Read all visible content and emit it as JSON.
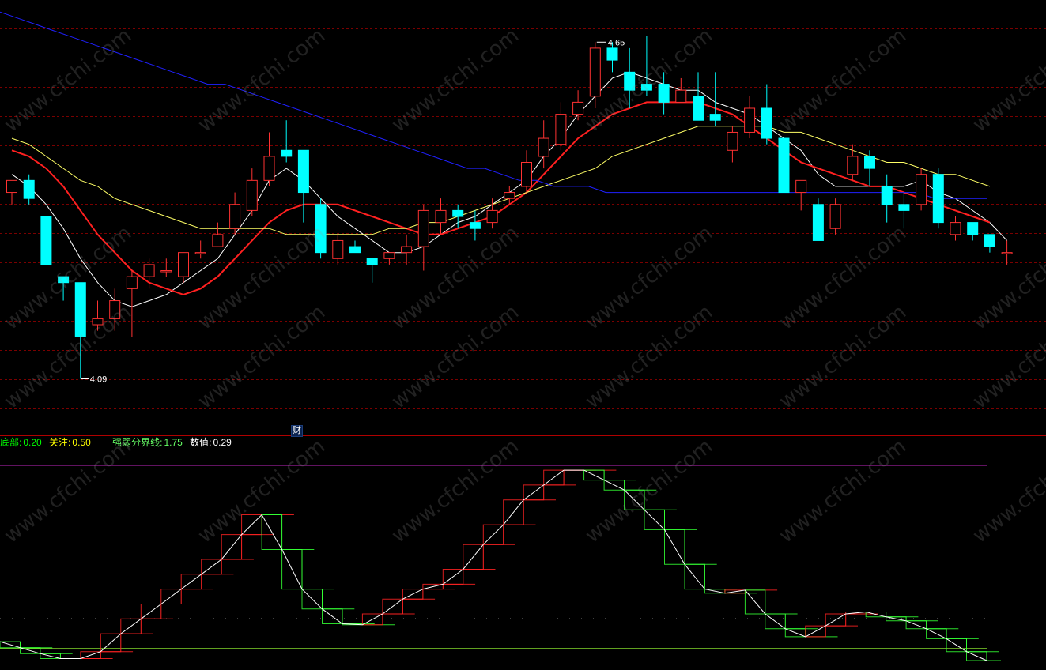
{
  "chart_data": [
    {
      "type": "candlestick",
      "title": "",
      "ylim": [
        4.0,
        4.72
      ],
      "max_label": "4.65",
      "min_label": "4.09",
      "badge": "财",
      "colors": {
        "up": "#ff3232",
        "down": "#00ffff",
        "ma_short": "#ffffff",
        "ma_mid": "#ff2020",
        "ma_long": "#ffff66",
        "ma_longest": "#2020ff",
        "grid": "#7a0000"
      },
      "candles": [
        {
          "o": 4.4,
          "c": 4.42,
          "h": 4.42,
          "l": 4.38
        },
        {
          "o": 4.42,
          "c": 4.39,
          "h": 4.43,
          "l": 4.38
        },
        {
          "o": 4.36,
          "c": 4.28,
          "h": 4.36,
          "l": 4.28
        },
        {
          "o": 4.26,
          "c": 4.25,
          "h": 4.26,
          "l": 4.22
        },
        {
          "o": 4.25,
          "c": 4.16,
          "h": 4.25,
          "l": 4.09
        },
        {
          "o": 4.18,
          "c": 4.19,
          "h": 4.22,
          "l": 4.17
        },
        {
          "o": 4.19,
          "c": 4.22,
          "h": 4.24,
          "l": 4.17
        },
        {
          "o": 4.24,
          "c": 4.26,
          "h": 4.27,
          "l": 4.16
        },
        {
          "o": 4.26,
          "c": 4.28,
          "h": 4.29,
          "l": 4.24
        },
        {
          "o": 4.27,
          "c": 4.27,
          "h": 4.29,
          "l": 4.26
        },
        {
          "o": 4.26,
          "c": 4.3,
          "h": 4.3,
          "l": 4.25
        },
        {
          "o": 4.3,
          "c": 4.3,
          "h": 4.32,
          "l": 4.29
        },
        {
          "o": 4.31,
          "c": 4.33,
          "h": 4.35,
          "l": 4.31
        },
        {
          "o": 4.34,
          "c": 4.38,
          "h": 4.4,
          "l": 4.33
        },
        {
          "o": 4.37,
          "c": 4.42,
          "h": 4.44,
          "l": 4.36
        },
        {
          "o": 4.42,
          "c": 4.46,
          "h": 4.5,
          "l": 4.41
        },
        {
          "o": 4.47,
          "c": 4.46,
          "h": 4.52,
          "l": 4.45
        },
        {
          "o": 4.47,
          "c": 4.4,
          "h": 4.47,
          "l": 4.35
        },
        {
          "o": 4.38,
          "c": 4.3,
          "h": 4.39,
          "l": 4.29
        },
        {
          "o": 4.29,
          "c": 4.32,
          "h": 4.33,
          "l": 4.28
        },
        {
          "o": 4.31,
          "c": 4.3,
          "h": 4.32,
          "l": 4.3
        },
        {
          "o": 4.29,
          "c": 4.28,
          "h": 4.29,
          "l": 4.25
        },
        {
          "o": 4.29,
          "c": 4.3,
          "h": 4.3,
          "l": 4.28
        },
        {
          "o": 4.3,
          "c": 4.31,
          "h": 4.33,
          "l": 4.28
        },
        {
          "o": 4.31,
          "c": 4.37,
          "h": 4.38,
          "l": 4.27
        },
        {
          "o": 4.35,
          "c": 4.37,
          "h": 4.39,
          "l": 4.33
        },
        {
          "o": 4.37,
          "c": 4.36,
          "h": 4.38,
          "l": 4.34
        },
        {
          "o": 4.35,
          "c": 4.34,
          "h": 4.37,
          "l": 4.32
        },
        {
          "o": 4.35,
          "c": 4.37,
          "h": 4.39,
          "l": 4.34
        },
        {
          "o": 4.39,
          "c": 4.4,
          "h": 4.41,
          "l": 4.38
        },
        {
          "o": 4.41,
          "c": 4.45,
          "h": 4.47,
          "l": 4.4
        },
        {
          "o": 4.46,
          "c": 4.49,
          "h": 4.52,
          "l": 4.44
        },
        {
          "o": 4.48,
          "c": 4.53,
          "h": 4.55,
          "l": 4.47
        },
        {
          "o": 4.53,
          "c": 4.55,
          "h": 4.57,
          "l": 4.52
        },
        {
          "o": 4.56,
          "c": 4.64,
          "h": 4.65,
          "l": 4.54
        },
        {
          "o": 4.64,
          "c": 4.62,
          "h": 4.65,
          "l": 4.6
        },
        {
          "o": 4.6,
          "c": 4.57,
          "h": 4.64,
          "l": 4.54
        },
        {
          "o": 4.58,
          "c": 4.57,
          "h": 4.66,
          "l": 4.56
        },
        {
          "o": 4.58,
          "c": 4.55,
          "h": 4.6,
          "l": 4.53
        },
        {
          "o": 4.55,
          "c": 4.57,
          "h": 4.59,
          "l": 4.55
        },
        {
          "o": 4.56,
          "c": 4.52,
          "h": 4.6,
          "l": 4.52
        },
        {
          "o": 4.53,
          "c": 4.52,
          "h": 4.6,
          "l": 4.51
        },
        {
          "o": 4.47,
          "c": 4.5,
          "h": 4.51,
          "l": 4.45
        },
        {
          "o": 4.5,
          "c": 4.54,
          "h": 4.56,
          "l": 4.49
        },
        {
          "o": 4.54,
          "c": 4.49,
          "h": 4.58,
          "l": 4.48
        },
        {
          "o": 4.49,
          "c": 4.4,
          "h": 4.49,
          "l": 4.37
        },
        {
          "o": 4.4,
          "c": 4.42,
          "h": 4.42,
          "l": 4.37
        },
        {
          "o": 4.38,
          "c": 4.32,
          "h": 4.39,
          "l": 4.32
        },
        {
          "o": 4.34,
          "c": 4.38,
          "h": 4.39,
          "l": 4.33
        },
        {
          "o": 4.43,
          "c": 4.46,
          "h": 4.48,
          "l": 4.42
        },
        {
          "o": 4.46,
          "c": 4.44,
          "h": 4.47,
          "l": 4.41
        },
        {
          "o": 4.41,
          "c": 4.38,
          "h": 4.43,
          "l": 4.35
        },
        {
          "o": 4.38,
          "c": 4.37,
          "h": 4.4,
          "l": 4.34
        },
        {
          "o": 4.38,
          "c": 4.43,
          "h": 4.44,
          "l": 4.37
        },
        {
          "o": 4.43,
          "c": 4.35,
          "h": 4.44,
          "l": 4.34
        },
        {
          "o": 4.33,
          "c": 4.35,
          "h": 4.36,
          "l": 4.32
        },
        {
          "o": 4.35,
          "c": 4.33,
          "h": 4.35,
          "l": 4.32
        },
        {
          "o": 4.33,
          "c": 4.31,
          "h": 4.33,
          "l": 4.3
        },
        {
          "o": 4.3,
          "c": 4.3,
          "h": 4.32,
          "l": 4.28
        }
      ],
      "ma": [
        {
          "name": "short",
          "color": "#ffffff",
          "width": 1,
          "values": [
            4.43,
            4.41,
            4.38,
            4.34,
            4.29,
            4.25,
            4.22,
            4.21,
            4.22,
            4.23,
            4.25,
            4.27,
            4.29,
            4.33,
            4.37,
            4.42,
            4.44,
            4.42,
            4.39,
            4.36,
            4.34,
            4.32,
            4.3,
            4.3,
            4.31,
            4.33,
            4.35,
            4.36,
            4.38,
            4.4,
            4.42,
            4.46,
            4.49,
            4.53,
            4.56,
            4.59,
            4.6,
            4.59,
            4.58,
            4.57,
            4.57,
            4.55,
            4.54,
            4.53,
            4.51,
            4.49,
            4.47,
            4.43,
            4.41,
            4.41,
            4.41,
            4.41,
            4.41,
            4.42,
            4.4,
            4.39,
            4.37,
            4.35,
            4.32
          ]
        },
        {
          "name": "mid",
          "color": "#ff2020",
          "width": 2,
          "values": [
            4.47,
            4.46,
            4.44,
            4.41,
            4.37,
            4.33,
            4.3,
            4.27,
            4.25,
            4.24,
            4.23,
            4.24,
            4.26,
            4.29,
            4.32,
            4.35,
            4.37,
            4.38,
            4.38,
            4.38,
            4.37,
            4.36,
            4.35,
            4.34,
            4.33,
            4.33,
            4.34,
            4.35,
            4.36,
            4.38,
            4.4,
            4.43,
            4.46,
            4.49,
            4.51,
            4.53,
            4.54,
            4.55,
            4.55,
            4.55,
            4.55,
            4.54,
            4.53,
            4.51,
            4.49,
            4.47,
            4.45,
            4.44,
            4.43,
            4.42,
            4.41,
            4.41,
            4.4,
            4.39,
            4.38,
            4.37,
            4.36,
            4.35
          ]
        },
        {
          "name": "long",
          "color": "#ffff66",
          "width": 1,
          "values": [
            4.49,
            4.48,
            4.46,
            4.44,
            4.42,
            4.41,
            4.39,
            4.38,
            4.37,
            4.36,
            4.35,
            4.34,
            4.34,
            4.34,
            4.34,
            4.34,
            4.33,
            4.33,
            4.33,
            4.33,
            4.33,
            4.33,
            4.34,
            4.34,
            4.35,
            4.35,
            4.36,
            4.37,
            4.38,
            4.39,
            4.4,
            4.41,
            4.42,
            4.43,
            4.44,
            4.46,
            4.47,
            4.48,
            4.49,
            4.5,
            4.51,
            4.51,
            4.51,
            4.51,
            4.51,
            4.5,
            4.5,
            4.49,
            4.48,
            4.47,
            4.46,
            4.45,
            4.45,
            4.44,
            4.43,
            4.43,
            4.42,
            4.41
          ]
        },
        {
          "name": "longest",
          "color": "#2020ff",
          "width": 1,
          "values": [
            4.7,
            4.69,
            4.68,
            4.67,
            4.66,
            4.65,
            4.64,
            4.63,
            4.62,
            4.61,
            4.6,
            4.59,
            4.58,
            4.58,
            4.57,
            4.56,
            4.55,
            4.54,
            4.53,
            4.52,
            4.51,
            4.5,
            4.49,
            4.48,
            4.47,
            4.46,
            4.45,
            4.44,
            4.44,
            4.43,
            4.42,
            4.42,
            4.41,
            4.41,
            4.41,
            4.4,
            4.4,
            4.4,
            4.4,
            4.4,
            4.4,
            4.4,
            4.4,
            4.4,
            4.4,
            4.4,
            4.4,
            4.4,
            4.4,
            4.4,
            4.4,
            4.4,
            4.4,
            4.4,
            4.39,
            4.39,
            4.39,
            4.39
          ]
        }
      ]
    },
    {
      "type": "line",
      "indicator_legend": [
        {
          "label": "底部:",
          "value": "0.20",
          "color": "#00ff00"
        },
        {
          "label": "关注:",
          "value": "0.50",
          "color": "#ffff00"
        },
        {
          "label": "强弱分界线:",
          "value": "1.75",
          "color": "#66ff66"
        },
        {
          "label": "数值:",
          "value": "0.29",
          "color": "#ffffff"
        }
      ],
      "ylim": [
        0.0,
        2.2
      ],
      "hlines": [
        {
          "value": 2.05,
          "color": "#ff33ff"
        },
        {
          "value": 1.75,
          "color": "#66ff99"
        },
        {
          "value": 0.5,
          "color": "#ffffff",
          "dotted": true
        },
        {
          "value": 0.2,
          "color": "#99ff33"
        }
      ],
      "values": [
        0.27,
        0.21,
        0.15,
        0.1,
        0.1,
        0.17,
        0.35,
        0.5,
        0.65,
        0.8,
        0.95,
        1.1,
        1.35,
        1.55,
        1.2,
        0.8,
        0.6,
        0.45,
        0.44,
        0.55,
        0.7,
        0.8,
        0.85,
        1.0,
        1.25,
        1.45,
        1.7,
        1.85,
        2.0,
        2.0,
        1.9,
        1.8,
        1.6,
        1.4,
        1.05,
        0.8,
        0.76,
        0.79,
        0.55,
        0.4,
        0.32,
        0.43,
        0.55,
        0.57,
        0.52,
        0.48,
        0.4,
        0.3,
        0.17,
        0.08
      ]
    }
  ],
  "watermark": "www.cfchi.com"
}
